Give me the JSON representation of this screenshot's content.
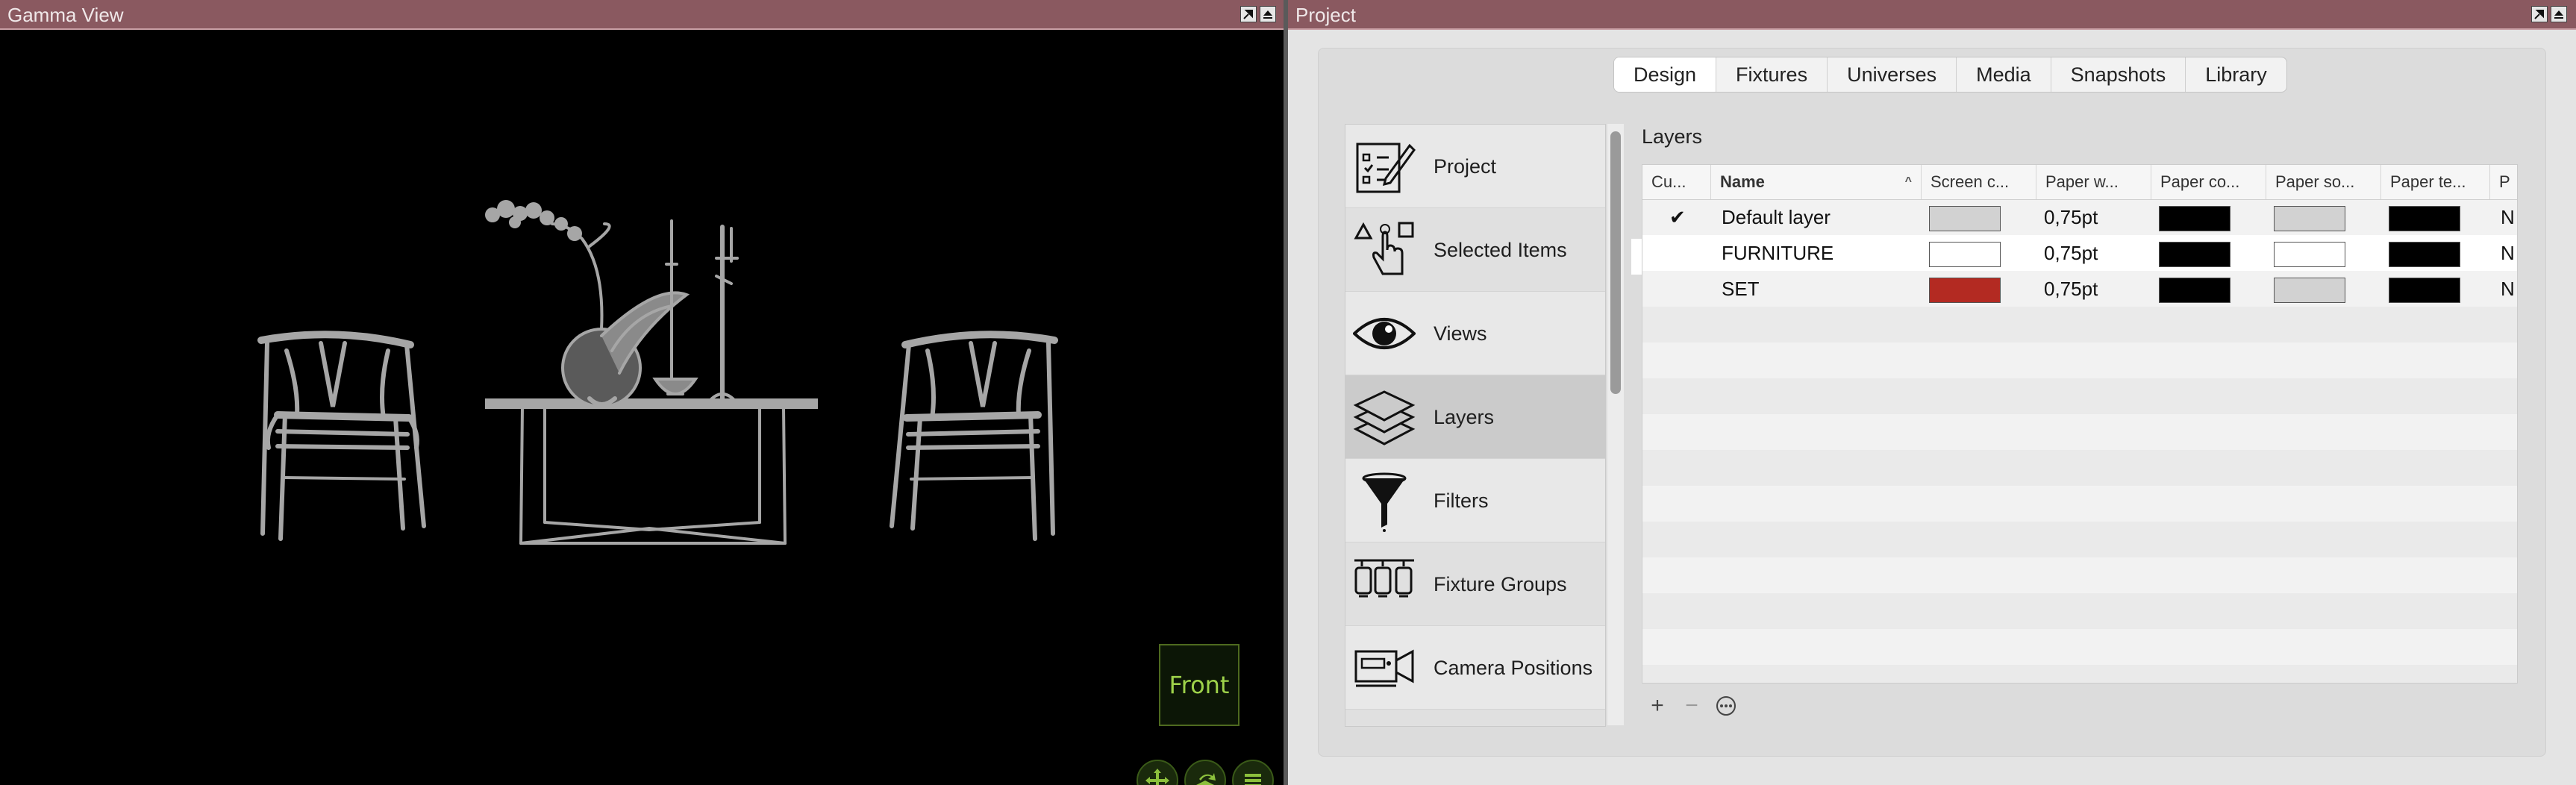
{
  "gamma": {
    "title": "Gamma View",
    "front_label": "Front",
    "tool_icons": [
      "move-icon",
      "orbit-icon",
      "menu-icon"
    ]
  },
  "project": {
    "title": "Project",
    "tabs": [
      "Design",
      "Fixtures",
      "Universes",
      "Media",
      "Snapshots",
      "Library"
    ],
    "active_tab": "Design",
    "sidebar": [
      {
        "label": "Project",
        "icon": "checklist-pen-icon"
      },
      {
        "label": "Selected Items",
        "icon": "shapes-hand-icon"
      },
      {
        "label": "Views",
        "icon": "eye-icon"
      },
      {
        "label": "Layers",
        "icon": "layers-icon",
        "selected": true
      },
      {
        "label": "Filters",
        "icon": "funnel-icon"
      },
      {
        "label": "Fixture Groups",
        "icon": "fixture-group-icon"
      },
      {
        "label": "Camera Positions",
        "icon": "camera-icon"
      }
    ],
    "section_title": "Layers",
    "columns": [
      "Cu...",
      "Name",
      "Screen c...",
      "Paper w...",
      "Paper co...",
      "Paper so...",
      "Paper te...",
      "P"
    ],
    "rows": [
      {
        "current": "✔",
        "name": "Default layer",
        "screen_color": "#d2d2d2",
        "paper_width": "0,75pt",
        "paper_color": "#000000",
        "paper_solid": "#d2d2d2",
        "paper_text": "#000000",
        "last": "N"
      },
      {
        "current": "",
        "name": "FURNITURE",
        "screen_color": "#ffffff",
        "paper_width": "0,75pt",
        "paper_color": "#000000",
        "paper_solid": "#ffffff",
        "paper_text": "#000000",
        "last": "N"
      },
      {
        "current": "",
        "name": "SET",
        "screen_color": "#b32a22",
        "paper_width": "0,75pt",
        "paper_color": "#000000",
        "paper_solid": "#d2d2d2",
        "paper_text": "#000000",
        "last": "N"
      }
    ],
    "footer": {
      "add": "+",
      "remove": "−",
      "more": "⋯"
    }
  }
}
